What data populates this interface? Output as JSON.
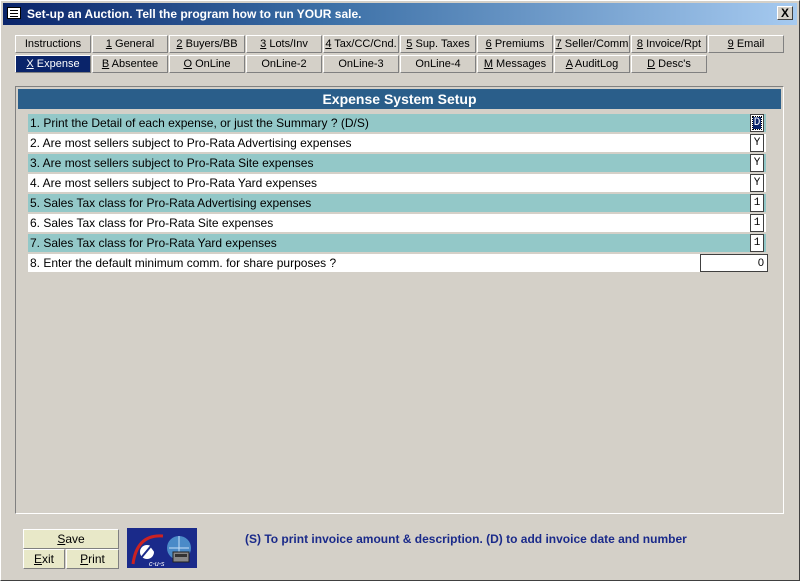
{
  "window": {
    "title": "Set-up an Auction.  Tell the program how to run YOUR sale.",
    "close_label": "X"
  },
  "tabs_row1": [
    {
      "acc": "",
      "label": "Instructions"
    },
    {
      "acc": "1",
      "label": " General"
    },
    {
      "acc": "2",
      "label": " Buyers/BB"
    },
    {
      "acc": "3",
      "label": " Lots/Inv"
    },
    {
      "acc": "4",
      "label": " Tax/CC/Cnd."
    },
    {
      "acc": "5",
      "label": " Sup. Taxes"
    },
    {
      "acc": "6",
      "label": " Premiums"
    },
    {
      "acc": "7",
      "label": " Seller/Comm"
    },
    {
      "acc": "8",
      "label": " Invoice/Rpt"
    },
    {
      "acc": "9",
      "label": " Email"
    }
  ],
  "tabs_row2": [
    {
      "acc": "X",
      "label": " Expense",
      "active": true
    },
    {
      "acc": "B",
      "label": " Absentee"
    },
    {
      "acc": "O",
      "label": " OnLine"
    },
    {
      "acc": "",
      "label": "OnLine-2"
    },
    {
      "acc": "",
      "label": "OnLine-3"
    },
    {
      "acc": "",
      "label": "OnLine-4"
    },
    {
      "acc": "M",
      "label": " Messages"
    },
    {
      "acc": "A",
      "label": " AuditLog"
    },
    {
      "acc": "D",
      "label": " Desc's"
    }
  ],
  "panel": {
    "title": "Expense System Setup",
    "rows": [
      {
        "label": "1. Print the Detail of each expense, or just the Summary ? (D/S)",
        "value": "D"
      },
      {
        "label": "2. Are most sellers subject to Pro-Rata Advertising expenses",
        "value": "Y"
      },
      {
        "label": "3. Are most sellers subject to Pro-Rata Site expenses",
        "value": "Y"
      },
      {
        "label": "4. Are most sellers subject to Pro-Rata Yard expenses",
        "value": "Y"
      },
      {
        "label": "5. Sales Tax class for Pro-Rata Advertising expenses",
        "value": "1"
      },
      {
        "label": "6. Sales Tax class for Pro-Rata Site expenses",
        "value": "1"
      },
      {
        "label": "7. Sales Tax class for Pro-Rata Yard expenses",
        "value": "1"
      },
      {
        "label": "8. Enter the default minimum comm. for share purposes ?",
        "value": "0"
      }
    ]
  },
  "buttons": {
    "save": {
      "acc": "S",
      "rest": "ave"
    },
    "exit": {
      "acc": "E",
      "rest": "xit"
    },
    "print": {
      "acc": "P",
      "rest": "rint"
    }
  },
  "logo_text": "c-u-s",
  "hint": "(S) To print invoice amount & description. (D) to add invoice date and number"
}
